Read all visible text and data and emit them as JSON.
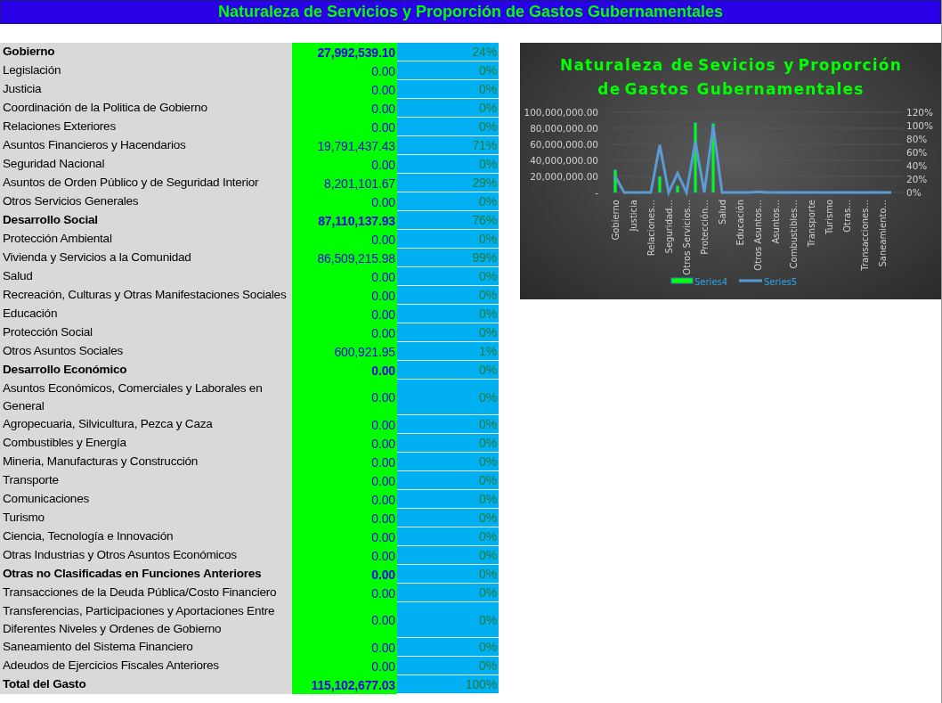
{
  "title": "Naturaleza de Servicios y Proporción de Gastos Gubernamentales",
  "rows": [
    {
      "kind": "group",
      "label": "Gobierno",
      "amount": "27,992,539.10",
      "share": "24%"
    },
    {
      "kind": "item",
      "label": "Legislación",
      "amount": "0.00",
      "share": "0%"
    },
    {
      "kind": "item",
      "label": "Justicia",
      "amount": "0.00",
      "share": "0%"
    },
    {
      "kind": "item",
      "label": "Coordinación de la Politica de Gobierno",
      "amount": "0.00",
      "share": "0%"
    },
    {
      "kind": "item",
      "label": "Relaciones Exteriores",
      "amount": "0.00",
      "share": "0%"
    },
    {
      "kind": "item",
      "label": "Asuntos Financieros y Hacendarios",
      "amount": "19,791,437.43",
      "share": "71%"
    },
    {
      "kind": "item",
      "label": "Seguridad Nacional",
      "amount": "0.00",
      "share": "0%"
    },
    {
      "kind": "item",
      "label": "Asuntos de Orden Público y de Seguridad Interior",
      "amount": "8,201,101.67",
      "share": "29%"
    },
    {
      "kind": "item",
      "label": "Otros Servicios Generales",
      "amount": "0.00",
      "share": "0%"
    },
    {
      "kind": "group",
      "label": "Desarrollo Social",
      "amount": "87,110,137.93",
      "share": "76%"
    },
    {
      "kind": "item",
      "label": "Protección Ambiental",
      "amount": "0.00",
      "share": "0%"
    },
    {
      "kind": "item",
      "label": "Vivienda y Servicios a la Comunidad",
      "amount": "86,509,215.98",
      "share": "99%"
    },
    {
      "kind": "item",
      "label": "Salud",
      "amount": "0.00",
      "share": "0%"
    },
    {
      "kind": "item",
      "label": "Recreación, Culturas y Otras Manifestaciones Sociales",
      "amount": "0.00",
      "share": "0%"
    },
    {
      "kind": "item",
      "label": "Educación",
      "amount": "0.00",
      "share": "0%"
    },
    {
      "kind": "item",
      "label": "Protección Social",
      "amount": "0.00",
      "share": "0%"
    },
    {
      "kind": "item",
      "label": "Otros Asuntos Sociales",
      "amount": "600,921.95",
      "share": "1%"
    },
    {
      "kind": "group",
      "label": "Desarrollo Económico",
      "amount": "0.00",
      "share": "0%"
    },
    {
      "kind": "item",
      "label": "Asuntos Económicos, Comerciales y Laborales en General",
      "amount": "0.00",
      "share": "0%"
    },
    {
      "kind": "item",
      "label": "Agropecuaria, Silvicultura, Pezca y Caza",
      "amount": "0.00",
      "share": "0%"
    },
    {
      "kind": "item",
      "label": "Combustibles y Energía",
      "amount": "0.00",
      "share": "0%"
    },
    {
      "kind": "item",
      "label": "Mineria, Manufacturas y Construcción",
      "amount": "0.00",
      "share": "0%"
    },
    {
      "kind": "item",
      "label": "Transporte",
      "amount": "0.00",
      "share": "0%"
    },
    {
      "kind": "item",
      "label": "Comunicaciones",
      "amount": "0.00",
      "share": "0%"
    },
    {
      "kind": "item",
      "label": "Turismo",
      "amount": "0.00",
      "share": "0%"
    },
    {
      "kind": "item",
      "label": "Ciencia, Tecnología e Innovación",
      "amount": "0.00",
      "share": "0%"
    },
    {
      "kind": "item",
      "label": "Otras Industrias y Otros Asuntos Económicos",
      "amount": "0.00",
      "share": "0%"
    },
    {
      "kind": "group",
      "label": "Otras no Clasificadas en Funciones Anteriores",
      "amount": "0.00",
      "share": "0%"
    },
    {
      "kind": "item",
      "label": "Transacciones de la Deuda Pública/Costo Financiero",
      "amount": "0.00",
      "share": "0%"
    },
    {
      "kind": "item",
      "label": "Transferencias, Participaciones y Aportaciones Entre Diferentes Niveles y Ordenes de Gobierno",
      "amount": "0.00",
      "share": "0%"
    },
    {
      "kind": "item",
      "label": "Saneamiento del Sistema Financiero",
      "amount": "0.00",
      "share": "0%"
    },
    {
      "kind": "item",
      "label": "Adeudos de Ejercicios Fiscales Anteriores",
      "amount": "0.00",
      "share": "0%"
    },
    {
      "kind": "total",
      "label": "Total del Gasto",
      "amount": "115,102,677.03",
      "share": "100%"
    }
  ],
  "chart": {
    "chart_data": {
      "type": "bar",
      "grid": true,
      "legend": true,
      "title": "Naturaleza  de Sevicios  y Proporción de Gastos  Gubernamentales",
      "categories": [
        "Gobierno",
        null,
        "Justicia",
        null,
        "Relaciones...",
        null,
        "Seguridad...",
        null,
        "Otros Servicios...",
        null,
        "Protección...",
        null,
        "Salud",
        null,
        "Educación",
        null,
        "Otros Asuntos...",
        null,
        "Asuntos...",
        null,
        "Combustibles...",
        null,
        "Transporte",
        null,
        "Turismo",
        null,
        "Otras...",
        null,
        "Transacciones...",
        null,
        "Saneamiento...",
        null
      ],
      "series": [
        {
          "name": "Series4",
          "color": "#00ff00",
          "values": [
            28000000,
            0,
            0,
            0,
            0,
            20000000,
            0,
            8000000,
            0,
            87000000,
            0,
            86000000,
            0,
            0,
            0,
            0,
            0,
            0,
            0,
            0,
            0,
            0,
            0,
            0,
            0,
            0,
            0,
            0,
            0,
            0,
            0,
            0
          ]
        },
        {
          "name": "Series5",
          "color": "#5b9bd5",
          "type": "line",
          "axis": "y2",
          "values": [
            24,
            0,
            0,
            0,
            0,
            71,
            0,
            29,
            0,
            76,
            0,
            99,
            0,
            0,
            0,
            0,
            1,
            0,
            0,
            0,
            0,
            0,
            0,
            0,
            0,
            0,
            0,
            0,
            0,
            0,
            0,
            0
          ]
        }
      ],
      "ylim": [
        0,
        100000000
      ],
      "yticks": [
        {
          "value": 0,
          "label": "-"
        },
        {
          "value": 20000000,
          "label": "20,000,000.00"
        },
        {
          "value": 40000000,
          "label": "40,000,000.00"
        },
        {
          "value": 60000000,
          "label": "60,000,000.00"
        },
        {
          "value": 80000000,
          "label": "80,000,000.00"
        },
        {
          "value": 100000000,
          "label": "100,000,000.00"
        }
      ],
      "y2lim": [
        0,
        120
      ],
      "y2ticks": [
        {
          "value": 0,
          "label": "0%"
        },
        {
          "value": 20,
          "label": "20%"
        },
        {
          "value": 40,
          "label": "40%"
        },
        {
          "value": 60,
          "label": "60%"
        },
        {
          "value": 80,
          "label": "80%"
        },
        {
          "value": 100,
          "label": "100%"
        },
        {
          "value": 120,
          "label": "120%"
        }
      ]
    }
  }
}
